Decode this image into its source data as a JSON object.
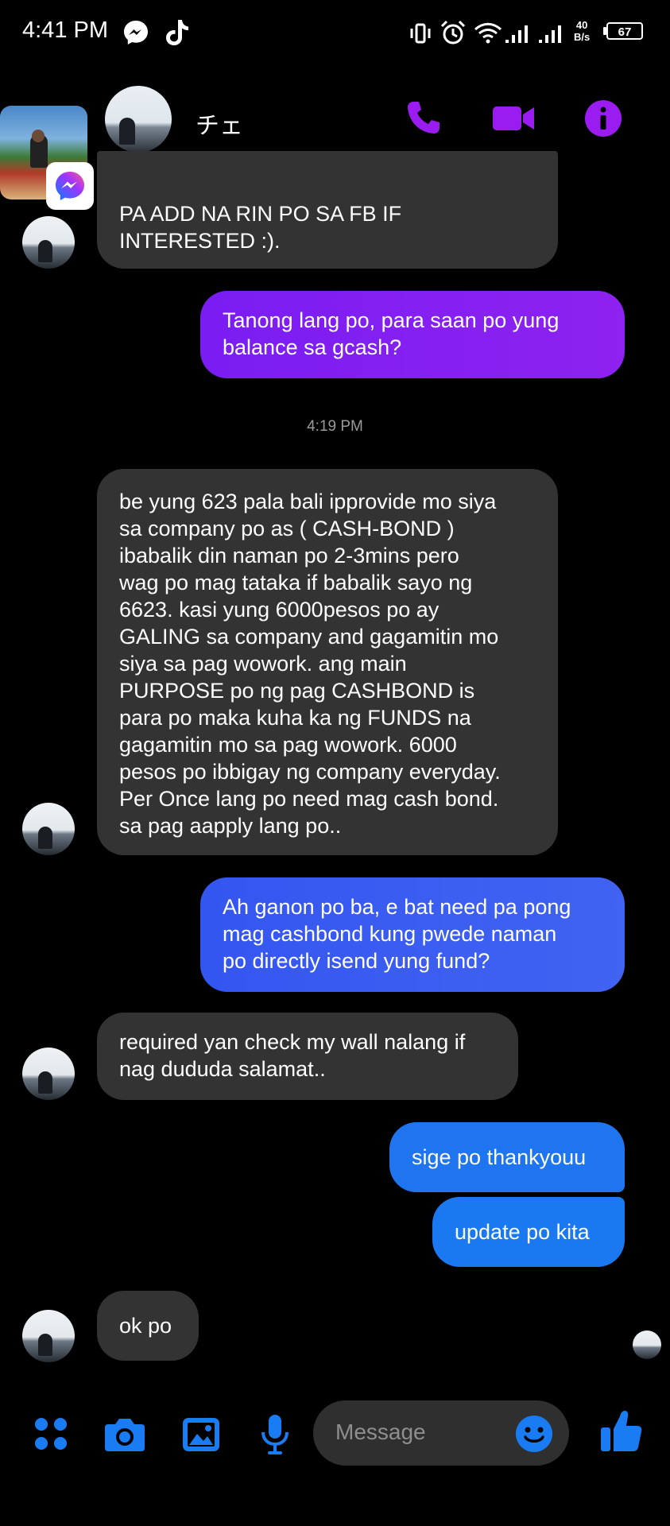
{
  "status_bar": {
    "time": "4:41 PM",
    "net_speed_value": "40",
    "net_speed_unit": "B/s",
    "battery": "67",
    "icons": [
      "messenger-icon",
      "tiktok-icon",
      "vibrate-icon",
      "alarm-icon",
      "wifi-icon",
      "signal-icon",
      "signal-icon"
    ]
  },
  "header": {
    "contact_name": "チェ",
    "actions": [
      "phone-icon",
      "video-icon",
      "info-icon"
    ],
    "accent_color": "#9b1cf0"
  },
  "messages": [
    {
      "side": "in",
      "lines": [
        "PA ADD NA RIN PO SA FB IF",
        "INTERESTED :)."
      ]
    },
    {
      "side": "out",
      "lines": [
        "Tanong lang po, para saan po yung",
        "balance sa gcash?"
      ],
      "color": "#8a1ff0"
    },
    {
      "side": "in",
      "lines": [
        "be yung 623 pala bali ipprovide mo siya",
        "sa company po as ( CASH-BOND )",
        "ibabalik din naman po 2-3mins pero",
        "wag po mag tataka if babalik sayo ng",
        "6623. kasi yung 6000pesos po ay",
        "GALING sa company and  gagamitin mo",
        "siya sa pag wowork. ang main",
        "PURPOSE po ng pag CASHBOND is",
        "para po maka kuha ka ng FUNDS na",
        "gagamitin mo sa pag wowork. 6000",
        "pesos po ibbigay ng company everyday.",
        "Per Once  lang po need mag cash bond.",
        "sa pag aapply lang po.."
      ]
    },
    {
      "side": "out",
      "lines": [
        "Ah ganon po ba, e bat need pa pong",
        "mag cashbond kung pwede naman",
        "po directly isend yung fund?"
      ],
      "color": "#3b5cf0"
    },
    {
      "side": "in",
      "lines": [
        "required yan check my wall nalang if",
        "nag dududa salamat.."
      ]
    },
    {
      "side": "out",
      "lines": [
        "sige po thankyouu"
      ],
      "color": "#1f74f0"
    },
    {
      "side": "out",
      "lines": [
        "update po kita"
      ],
      "color": "#1a78f0"
    },
    {
      "side": "in",
      "lines": [
        "ok po"
      ]
    }
  ],
  "timestamp": "4:19 PM",
  "composer": {
    "placeholder": "Message",
    "icons": [
      "menu-dots-icon",
      "camera-icon",
      "gallery-icon",
      "microphone-icon",
      "emoji-icon",
      "thumbs-up-icon"
    ],
    "accent_color": "#1a7cf2"
  }
}
